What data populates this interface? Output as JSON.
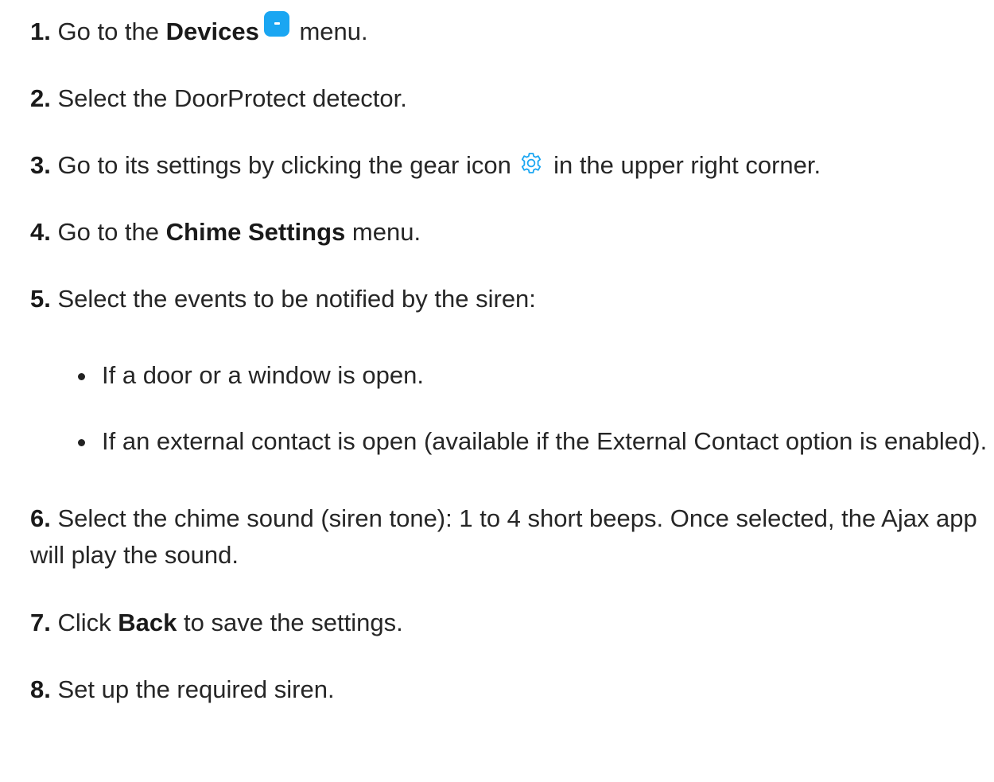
{
  "steps": [
    {
      "num": "1.",
      "before": "Go to the",
      "strong": "Devices",
      "after": "menu.",
      "icon": "devices-icon"
    },
    {
      "num": "2.",
      "text": "Select the DoorProtect detector."
    },
    {
      "num": "3.",
      "before": "Go to its settings by clicking the gear icon",
      "after": "in the upper right corner.",
      "icon": "gear-icon"
    },
    {
      "num": "4.",
      "before": "Go to the",
      "strong": "Chime Settings",
      "after": "menu."
    },
    {
      "num": "5.",
      "text": "Select the events to be notified by the siren:"
    },
    {
      "num": "6.",
      "text": "Select the chime sound (siren tone): 1 to 4 short beeps. Once selected, the Ajax app will play the sound."
    },
    {
      "num": "7.",
      "before": "Click",
      "strong": "Back",
      "after": "to save the settings."
    },
    {
      "num": "8.",
      "text": "Set up the required siren."
    }
  ],
  "bullets": [
    "If a door or a window is open.",
    "If an external contact is open (available if the External Contact option is enabled)."
  ],
  "colors": {
    "accent": "#1aa6f2",
    "text": "#262626"
  }
}
